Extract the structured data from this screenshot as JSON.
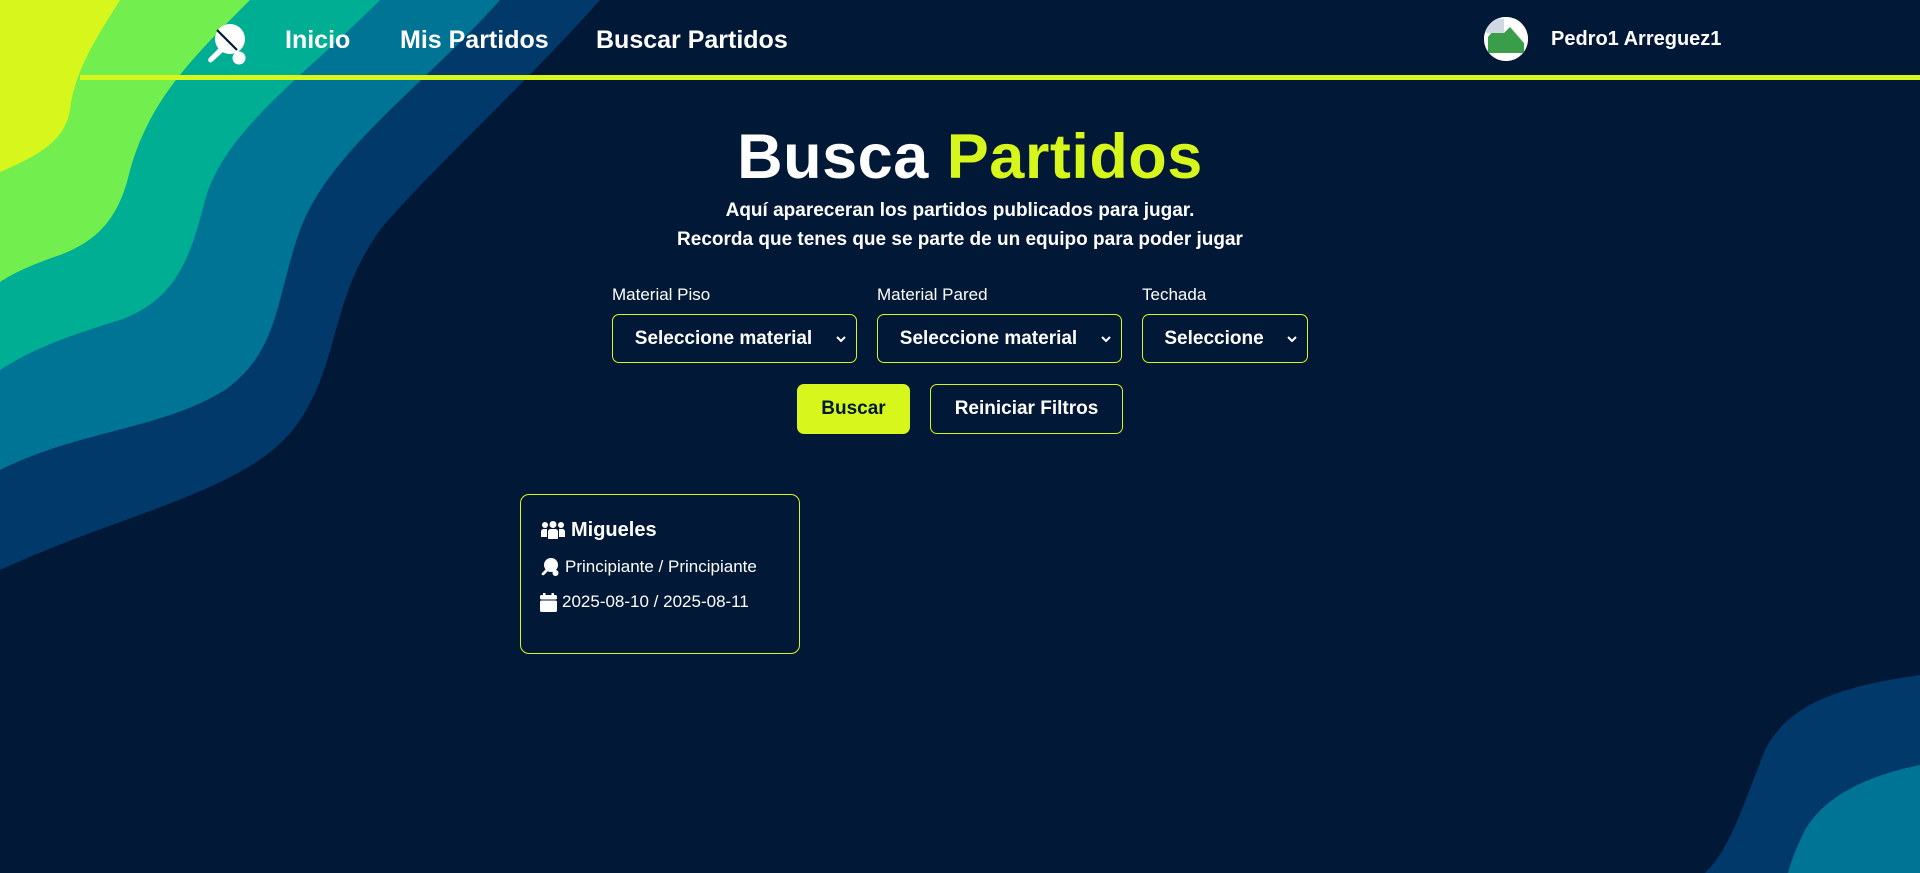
{
  "nav": {
    "links": [
      {
        "label": "Inicio"
      },
      {
        "label": "Mis Partidos"
      },
      {
        "label": "Buscar Partidos"
      }
    ],
    "user_name": "Pedro1 Arreguez1"
  },
  "header": {
    "title_white": "Busca",
    "title_accent": "Partidos",
    "subtitle_line1": "Aquí apareceran los partidos publicados para jugar.",
    "subtitle_line2": "Recorda que tenes que se parte de un equipo para poder jugar"
  },
  "filters": [
    {
      "label": "Material Piso",
      "selected": "Seleccione material"
    },
    {
      "label": "Material Pared",
      "selected": "Seleccione material"
    },
    {
      "label": "Techada",
      "selected": "Seleccione"
    }
  ],
  "buttons": {
    "search": "Buscar",
    "reset": "Reiniciar Filtros"
  },
  "matches": [
    {
      "team": "Migueles",
      "level": "Principiante / Principiante",
      "dates": "2025-08-10 / 2025-08-11"
    }
  ],
  "colors": {
    "background": "#011836",
    "accent": "#d7f71c",
    "wave_green": "#72ef4f",
    "wave_teal": "#00ae94",
    "wave_blue": "#007495",
    "wave_navy": "#00396a"
  },
  "icons": {
    "logo": "ping-pong-paddle-icon",
    "team": "users-icon",
    "level": "ping-pong-paddle-icon",
    "dates": "calendar-icon",
    "select": "chevron-down-icon"
  }
}
